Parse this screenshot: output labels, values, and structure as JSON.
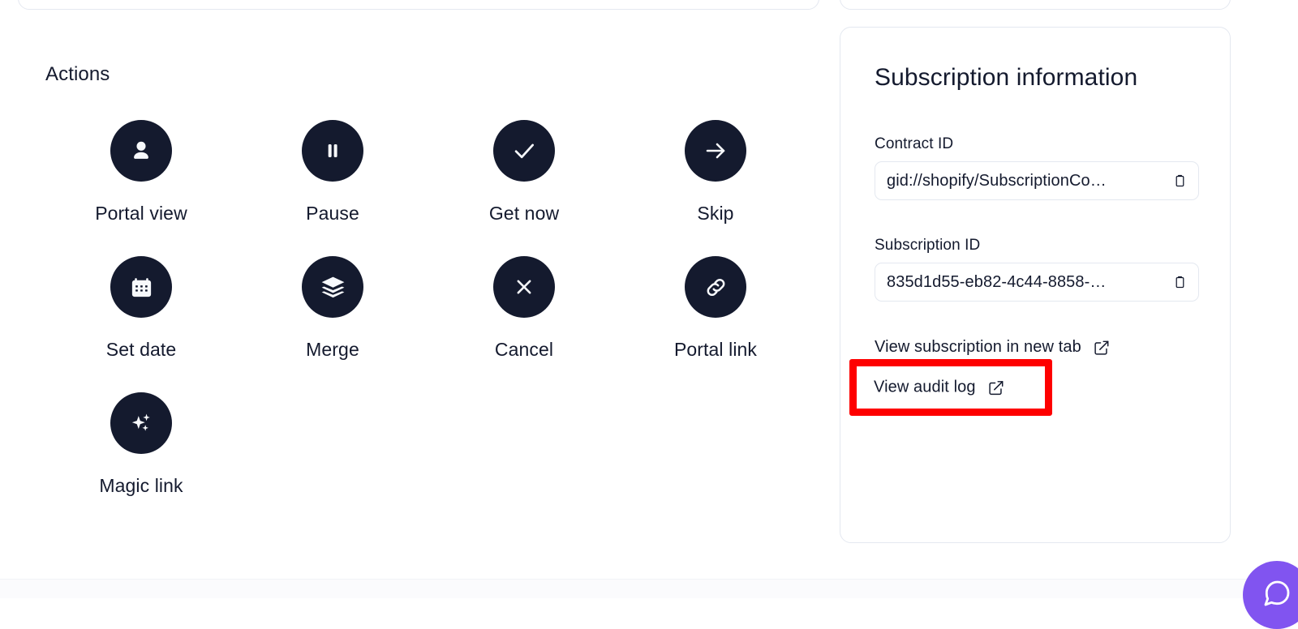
{
  "actions": {
    "section_title": "Actions",
    "items": [
      {
        "label": "Portal view",
        "icon": "user-icon"
      },
      {
        "label": "Pause",
        "icon": "pause-icon"
      },
      {
        "label": "Get now",
        "icon": "check-icon"
      },
      {
        "label": "Skip",
        "icon": "arrow-right-icon"
      },
      {
        "label": "Set date",
        "icon": "calendar-icon"
      },
      {
        "label": "Merge",
        "icon": "layers-icon"
      },
      {
        "label": "Cancel",
        "icon": "close-x-icon"
      },
      {
        "label": "Portal link",
        "icon": "chain-link-icon"
      },
      {
        "label": "Magic link",
        "icon": "sparkles-icon"
      }
    ]
  },
  "subscription_info": {
    "title": "Subscription information",
    "contract": {
      "label": "Contract ID",
      "value": "gid://shopify/SubscriptionCo…",
      "copy_icon": "clipboard-icon"
    },
    "subscription": {
      "label": "Subscription ID",
      "value": "835d1d55-eb82-4c44-8858-…",
      "copy_icon": "clipboard-icon"
    },
    "links": [
      {
        "label": "View subscription in new tab",
        "icon": "external-link-icon"
      },
      {
        "label": "View audit log",
        "icon": "external-link-icon"
      }
    ]
  },
  "chat": {
    "icon": "chat-bubble-icon",
    "color": "#8154f0"
  },
  "colors": {
    "icon_circle": "#141a2e",
    "text": "#141a2e",
    "card_border": "#e4e8f0",
    "highlight": "#fe0000"
  }
}
